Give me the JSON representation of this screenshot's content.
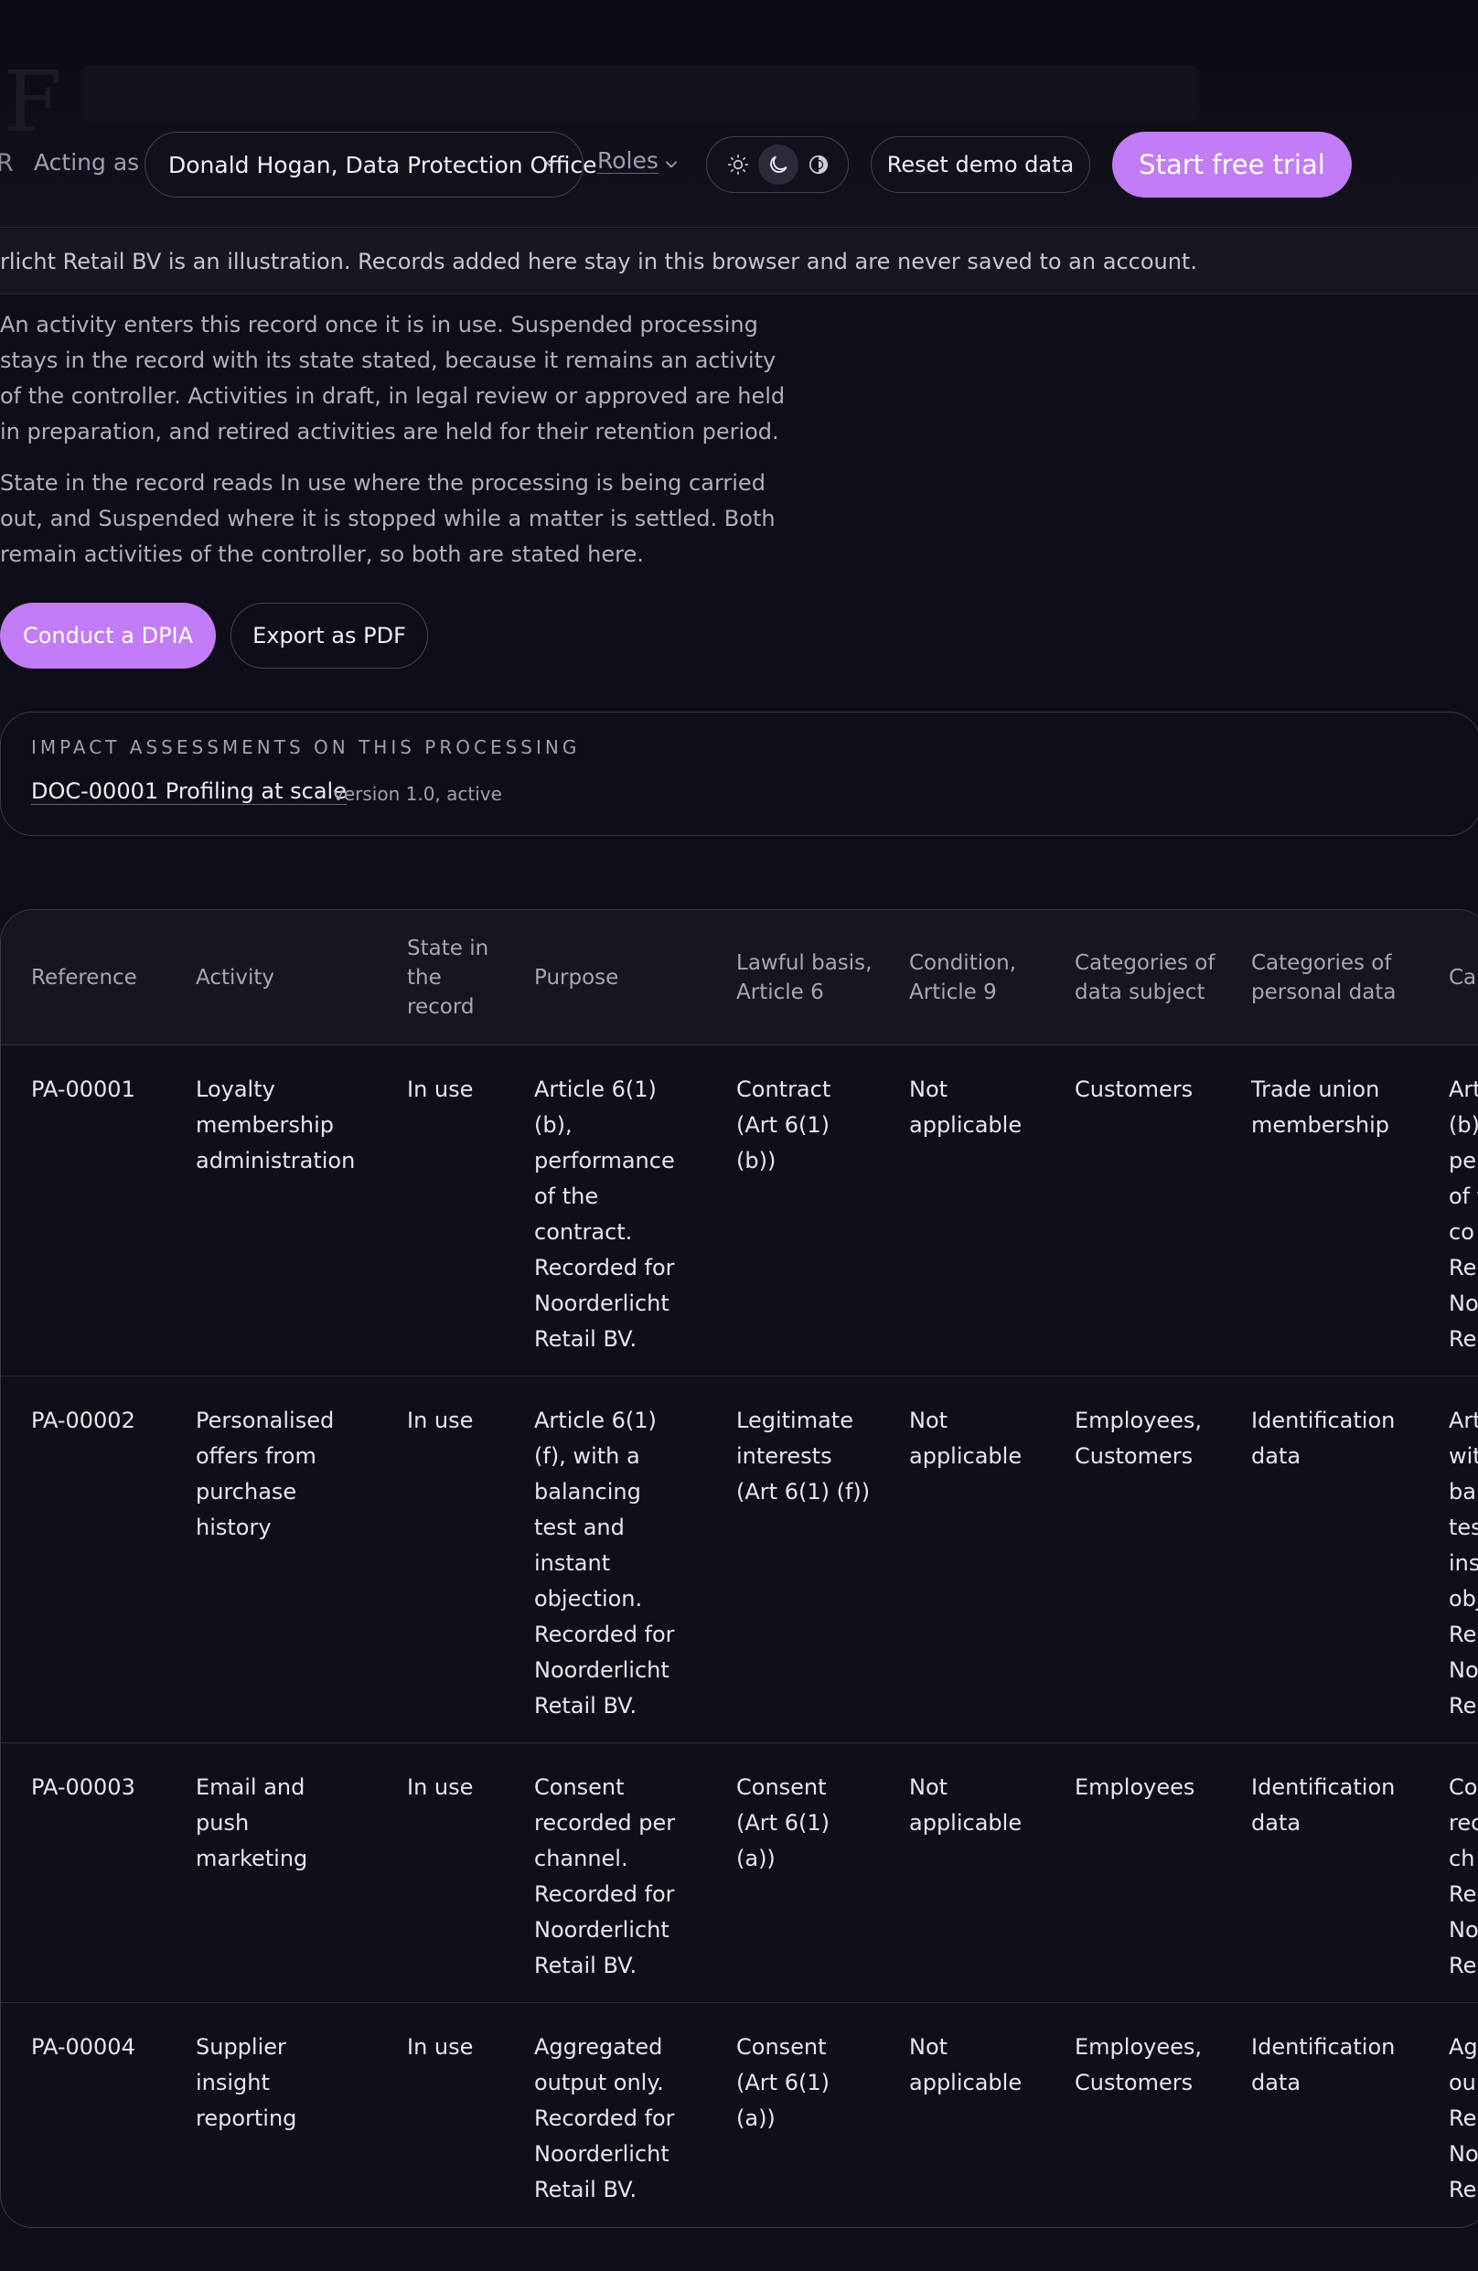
{
  "header": {
    "title_fragment": "F",
    "edge_letter": "R",
    "acting_as_label": "Acting as",
    "acting_as_value": "Donald Hogan, Data Protection Office",
    "roles_label": "Roles",
    "theme_options": [
      "sun-icon",
      "moon-icon",
      "contrast-icon"
    ],
    "theme_selected": "moon-icon",
    "reset_label": "Reset demo data",
    "trial_label": "Start free trial",
    "accent_color": "#c27cf5"
  },
  "notice": "rlicht Retail BV is an illustration. Records added here stay in this browser and are never saved to an account.",
  "intro": {
    "para1": "An activity enters this record once it is in use. Suspended processing stays in the record with its state stated, because it remains an activity of the controller. Activities in draft, in legal review or approved are held in preparation, and retired activities are held for their retention period.",
    "para2": "State in the record reads In use where the processing is being carried out, and Suspended where it is stopped while a matter is settled. Both remain activities of the controller, so both are stated here."
  },
  "actions": {
    "dpia_label": "Conduct a DPIA",
    "pdf_label": "Export as PDF"
  },
  "assessments": {
    "heading": "IMPACT ASSESSMENTS ON THIS PROCESSING",
    "link": "DOC-00001 Profiling at scale",
    "meta": "version 1.0, active"
  },
  "table": {
    "headers": {
      "ref": "Reference",
      "act": "Activity",
      "state": "State in the record",
      "purp": "Purpose",
      "law": "Lawful basis, Article 6",
      "cond": "Condition, Article 9",
      "subj": "Categories of data subject",
      "pers": "Categories of personal data",
      "rec": "Ca rec"
    },
    "rows": [
      {
        "ref": "PA-00001",
        "act": "Loyalty membership administration",
        "state": "In use",
        "purp": "Article 6(1) (b), performance of the contract. Recorded for Noorderlicht Retail BV.",
        "law": "Contract (Art 6(1) (b))",
        "cond": "Not applicable",
        "subj": "Customers",
        "pers": "Trade union membership",
        "rec": "Art\n(b)\npe\nof t\nco\nRe\nNo\nRe"
      },
      {
        "ref": "PA-00002",
        "act": "Personalised offers from purchase history",
        "state": "In use",
        "purp": "Article 6(1) (f), with a balancing test and instant objection. Recorded for Noorderlicht Retail BV.",
        "law": "Legitimate interests (Art 6(1) (f))",
        "cond": "Not applicable",
        "subj": "Employees, Customers",
        "pers": "Identification data",
        "rec": "Art\nwit\nba\ntes\nins\nobj\nRe\nNo\nRe"
      },
      {
        "ref": "PA-00003",
        "act": "Email and push marketing",
        "state": "In use",
        "purp": "Consent recorded per channel. Recorded for Noorderlicht Retail BV.",
        "law": "Consent (Art 6(1) (a))",
        "cond": "Not applicable",
        "subj": "Employees",
        "pers": "Identification data",
        "rec": "Co\nrec\nch\nRe\nNo\nRe"
      },
      {
        "ref": "PA-00004",
        "act": "Supplier insight reporting",
        "state": "In use",
        "purp": "Aggregated output only. Recorded for Noorderlicht Retail BV.",
        "law": "Consent (Art 6(1) (a))",
        "cond": "Not applicable",
        "subj": "Employees, Customers",
        "pers": "Identification data",
        "rec": "Ag\nou\nRe\nNo\nRe"
      }
    ]
  }
}
